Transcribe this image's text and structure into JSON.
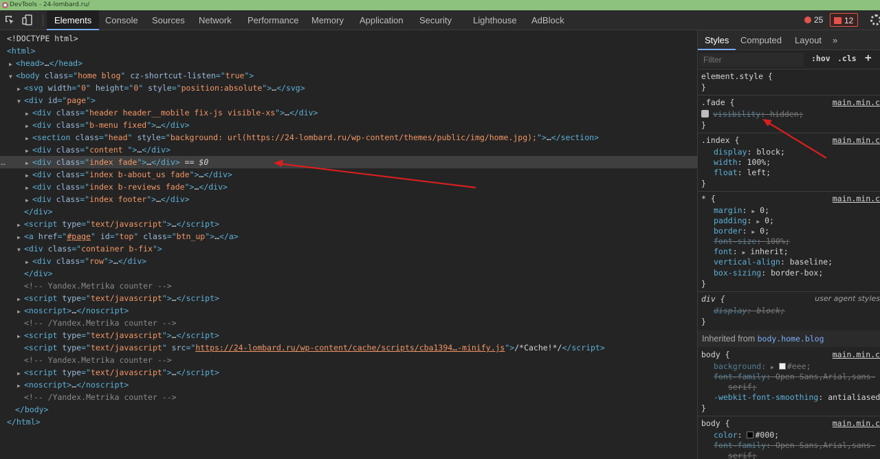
{
  "window": {
    "title": "DevTools - 24-lombard.ru/"
  },
  "toolbar": {
    "tabs": [
      "Elements",
      "Console",
      "Sources",
      "Network",
      "Performance",
      "Memory",
      "Application",
      "Security",
      "Lighthouse",
      "AdBlock"
    ],
    "errors_count": "25",
    "warnings_count": "12"
  },
  "elements": {
    "selected_suffix": "== $0",
    "lines": {
      "doctype": "<!DOCTYPE html>",
      "html_open": "<html>",
      "head": [
        "head",
        "…"
      ],
      "body_open": {
        "tag": "body",
        "a1": "class",
        "v1": "home blog",
        "a2": "cz-shortcut-listen",
        "v2": "true"
      },
      "svg": {
        "a1": "width",
        "v1": "0",
        "a2": "height",
        "v2": "0",
        "a3": "style",
        "v3": "position:absolute"
      },
      "div_page": {
        "a": "id",
        "v": "page"
      },
      "div_header": "header header__mobile fix-js visible-xs",
      "div_bmenu": "b-menu fixed",
      "section_head": {
        "c": "head",
        "s": "background: url(https://24-lombard.ru/wp-content/themes/public/img/home.jpg);"
      },
      "div_content": "content ",
      "div_index_fade": "index fade",
      "div_about": "index b-about_us fade",
      "div_reviews": "index b-reviews fade",
      "div_footer": "index footer",
      "script_type": "text/javascript",
      "a_href": "#page",
      "a_id": "top",
      "a_class": "btn_up",
      "div_container": "container b-fix",
      "div_row": "row",
      "comment_metrika": "<!-- Yandex.Metrika counter -->",
      "comment_metrika_end": "<!-- /Yandex.Metrika counter -->",
      "script_src": "https://24-lombard.ru/wp-content/cache/scripts/cba1394…-minify.js",
      "script_text": "/*Cache!*/"
    }
  },
  "styles": {
    "tabs": [
      "Styles",
      "Computed",
      "Layout",
      "»"
    ],
    "filter_placeholder": "Filter",
    "hov": ":hov",
    "cls": ".cls",
    "plus": "+",
    "element_style": "element.style {",
    "close_brace": "}",
    "source": "main.min.c",
    "ua_label": "user agent styles",
    "inherited_label": "Inherited from ",
    "inherited_link": "body.home.blog",
    "rules": {
      "fade": {
        "selector": ".fade {",
        "prop": "visibility",
        "value": "hidden;"
      },
      "index": {
        "selector": ".index {",
        "props": [
          [
            "display",
            "block;"
          ],
          [
            "width",
            "100%;"
          ],
          [
            "float",
            "left;"
          ]
        ]
      },
      "star": {
        "selector": "* {",
        "props": [
          [
            "margin",
            "0;"
          ],
          [
            "padding",
            "0;"
          ],
          [
            "border",
            "0;"
          ],
          [
            "font-size",
            "100%;"
          ],
          [
            "font",
            "inherit;"
          ],
          [
            "vertical-align",
            "baseline;"
          ],
          [
            "box-sizing",
            "border-box;"
          ]
        ]
      },
      "div": {
        "selector": "div {",
        "prop": "display",
        "value": "block;"
      },
      "body1": {
        "selector": "body {",
        "background": "#eee;",
        "font_family": "Open Sans,Arial,sans-",
        "font_family_2": "serif;",
        "smoothing_prop": "-webkit-font-smoothing",
        "smoothing_value": "antialiased"
      },
      "body2": {
        "selector": "body {",
        "color": "#000;",
        "font_family": "Open Sans,Arial,sans-",
        "font_family_2": "serif;"
      }
    }
  },
  "colors": {
    "annotation_arrow": "#d81f1f",
    "accent_tab": "#7cacf8",
    "error_red": "#e4534b"
  }
}
